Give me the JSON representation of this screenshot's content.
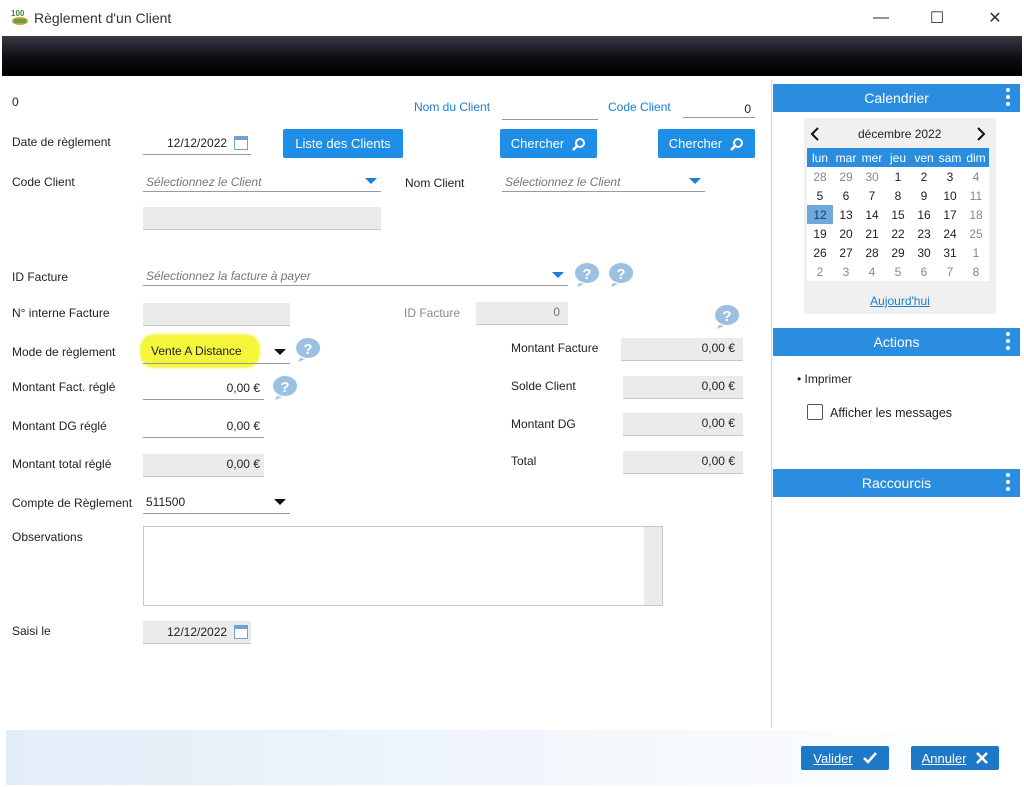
{
  "window": {
    "title": "Règlement d'un Client",
    "minimize": "—",
    "maximize": "☐",
    "close": "✕"
  },
  "top": {
    "zero": "0",
    "nom_du_client_label": "Nom du Client",
    "code_client_label": "Code Client",
    "code_client_value": "0"
  },
  "form": {
    "date_reglement_label": "Date de règlement",
    "date_reglement_value": "12/12/2022",
    "liste_clients_btn": "Liste des Clients",
    "chercher_btn": "Chercher",
    "chercher_btn2": "Chercher",
    "code_client_label": "Code Client",
    "code_client_placeholder": "Sélectionnez le Client",
    "nom_client_label": "Nom Client",
    "nom_client_placeholder": "Sélectionnez le Client",
    "id_facture_label": "ID Facture",
    "id_facture_placeholder": "Sélectionnez la facture à payer",
    "n_interne_label": "N° interne Facture",
    "id_facture2_label": "ID Facture",
    "id_facture2_value": "0",
    "mode_reglement_label": "Mode de règlement",
    "mode_reglement_value": "Vente A Distance",
    "montant_fact_regle_label": "Montant Fact. réglé",
    "montant_fact_regle_value": "0,00 €",
    "montant_dg_regle_label": "Montant DG réglé",
    "montant_dg_regle_value": "0,00 €",
    "montant_total_regle_label": "Montant total réglé",
    "montant_total_regle_value": "0,00 €",
    "montant_facture_label": "Montant Facture",
    "montant_facture_value": "0,00 €",
    "solde_client_label": "Solde Client",
    "solde_client_value": "0,00 €",
    "montant_dg_label": "Montant DG",
    "montant_dg_value": "0,00 €",
    "total_label": "Total",
    "total_value": "0,00 €",
    "compte_label": "Compte de Règlement",
    "compte_value": "511500",
    "observations_label": "Observations",
    "saisi_le_label": "Saisi le",
    "saisi_le_value": "12/12/2022"
  },
  "calendar": {
    "header": "Calendrier",
    "month": "décembre 2022",
    "days": [
      "lun",
      "mar",
      "mer",
      "jeu",
      "ven",
      "sam",
      "dim"
    ],
    "weeks": [
      [
        [
          "28",
          true
        ],
        [
          "29",
          true
        ],
        [
          "30",
          true
        ],
        [
          "1",
          false
        ],
        [
          "2",
          false
        ],
        [
          "3",
          false
        ],
        [
          "4",
          true
        ]
      ],
      [
        [
          "5",
          false
        ],
        [
          "6",
          false
        ],
        [
          "7",
          false
        ],
        [
          "8",
          false
        ],
        [
          "9",
          false
        ],
        [
          "10",
          false
        ],
        [
          "11",
          true
        ]
      ],
      [
        [
          "12",
          false
        ],
        [
          "13",
          false
        ],
        [
          "14",
          false
        ],
        [
          "15",
          false
        ],
        [
          "16",
          false
        ],
        [
          "17",
          false
        ],
        [
          "18",
          true
        ]
      ],
      [
        [
          "19",
          false
        ],
        [
          "20",
          false
        ],
        [
          "21",
          false
        ],
        [
          "22",
          false
        ],
        [
          "23",
          false
        ],
        [
          "24",
          false
        ],
        [
          "25",
          true
        ]
      ],
      [
        [
          "26",
          false
        ],
        [
          "27",
          false
        ],
        [
          "28",
          false
        ],
        [
          "29",
          false
        ],
        [
          "30",
          false
        ],
        [
          "31",
          false
        ],
        [
          "1",
          true
        ]
      ],
      [
        [
          "2",
          true
        ],
        [
          "3",
          true
        ],
        [
          "4",
          true
        ],
        [
          "5",
          true
        ],
        [
          "6",
          true
        ],
        [
          "7",
          true
        ],
        [
          "8",
          true
        ]
      ]
    ],
    "selected": "12",
    "today": "Aujourd'hui"
  },
  "actions": {
    "header": "Actions",
    "imprimer": "• Imprimer",
    "afficher": "Afficher les messages"
  },
  "raccourcis": {
    "header": "Raccourcis"
  },
  "footer": {
    "valider": "Valider",
    "annuler": "Annuler"
  },
  "colors": {
    "accent": "#2b8de0",
    "highlight": "#f5f53a",
    "dark_footer_btn": "#1e78c8"
  }
}
